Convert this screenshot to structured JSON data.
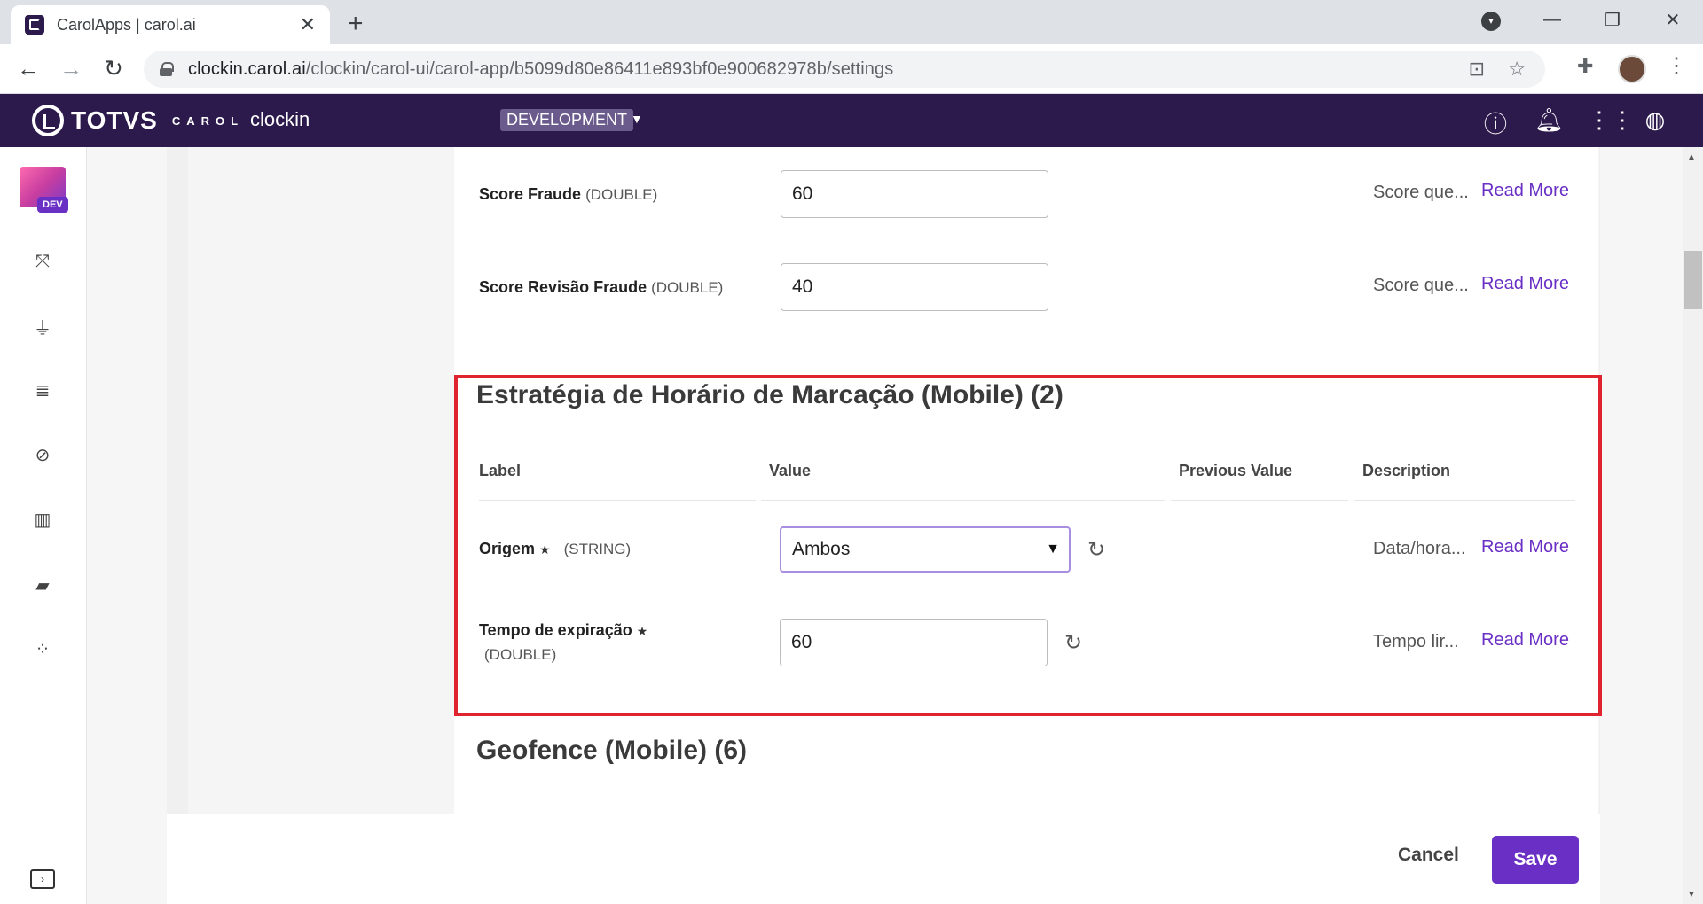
{
  "browser": {
    "tab_title": "CarolApps | carol.ai",
    "url_host": "clockin.carol.ai",
    "url_path": "/clockin/carol-ui/carol-app/b5099d80e86411e893bf0e900682978b/settings"
  },
  "header": {
    "brand": "TOTVS",
    "brand_sub": "CAROL",
    "app_name": "clockin",
    "environment": "DEVELOPMENT"
  },
  "rail": {
    "badge": "DEV"
  },
  "rows_top": [
    {
      "label": "Score Fraude",
      "type": "(DOUBLE)",
      "value": "60",
      "description": "Score que...",
      "read_more": "Read More"
    },
    {
      "label": "Score Revisão Fraude",
      "type": "(DOUBLE)",
      "value": "40",
      "description": "Score que...",
      "read_more": "Read More"
    }
  ],
  "section_mobile": {
    "title": "Estratégia de Horário de Marcação (Mobile) (2)",
    "columns": [
      "Label",
      "Value",
      "Previous Value",
      "Description"
    ],
    "rows": [
      {
        "label": "Origem",
        "required": "★",
        "type": "(STRING)",
        "value": "Ambos",
        "description": "Data/hora...",
        "read_more": "Read More"
      },
      {
        "label": "Tempo de expiração",
        "required": "★",
        "type": "(DOUBLE)",
        "value": "60",
        "description": "Tempo lir...",
        "read_more": "Read More"
      }
    ]
  },
  "section_geofence": {
    "title": "Geofence (Mobile) (6)"
  },
  "footer": {
    "cancel": "Cancel",
    "save": "Save"
  },
  "colors": {
    "brand_purple": "#2c1a4d",
    "accent": "#6a2fc4",
    "highlight": "#e0242f"
  }
}
